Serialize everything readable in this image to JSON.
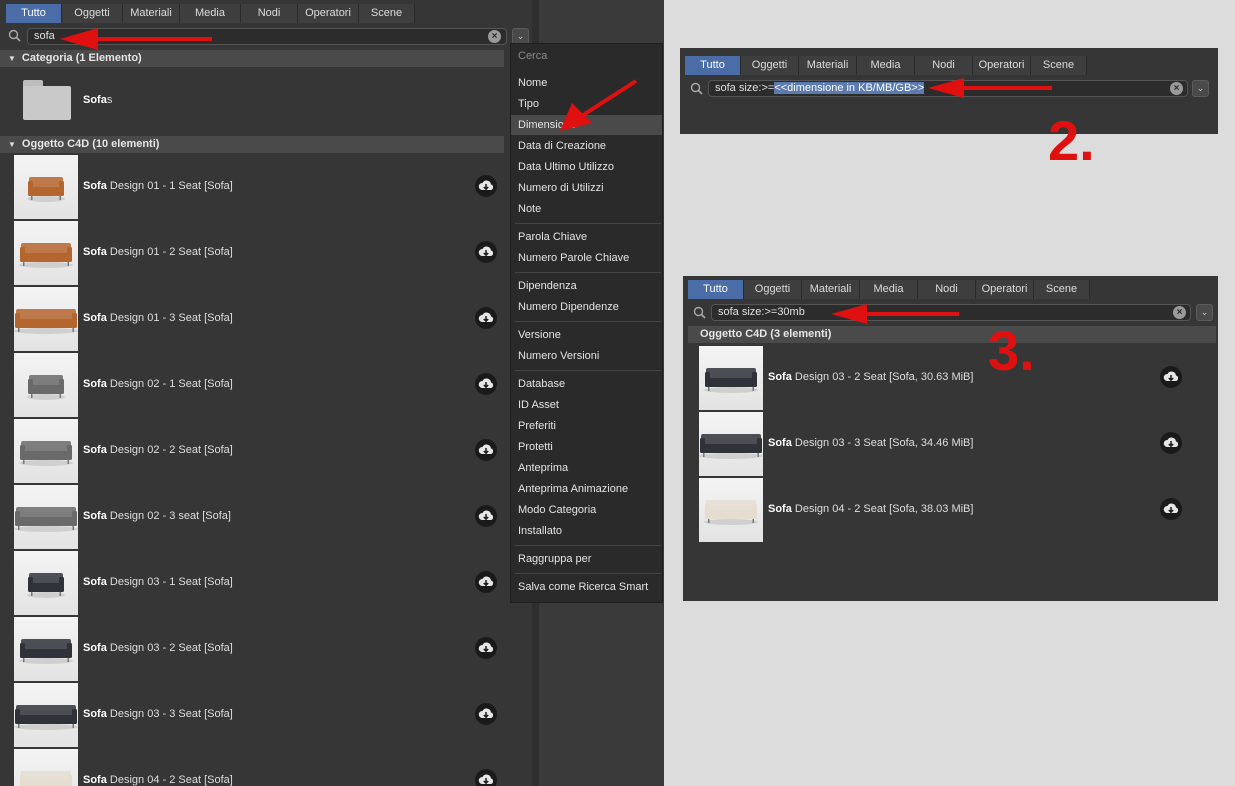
{
  "tabs": [
    "Tutto",
    "Oggetti",
    "Materiali",
    "Media",
    "Nodi",
    "Operatori",
    "Scene"
  ],
  "main": {
    "search_value": "sofa",
    "category_header": "Categoria (1 Elemento)",
    "folder_label_bold": "Sofa",
    "folder_label_rest": "s",
    "objects_header": "Oggetto C4D (10 elementi)",
    "items": [
      {
        "bold": "Sofa",
        "rest": " Design 01 - 1 Seat [Sofa]",
        "color": "#b5652e",
        "kind": "armchair"
      },
      {
        "bold": "Sofa",
        "rest": " Design 01 - 2 Seat [Sofa]",
        "color": "#b5652e",
        "kind": "sofa2"
      },
      {
        "bold": "Sofa",
        "rest": " Design 01 - 3 Seat [Sofa]",
        "color": "#b5652e",
        "kind": "sofa3"
      },
      {
        "bold": "Sofa",
        "rest": " Design 02 - 1 Seat [Sofa]",
        "color": "#6a6a6a",
        "kind": "armchair"
      },
      {
        "bold": "Sofa",
        "rest": " Design 02 - 2 Seat [Sofa]",
        "color": "#6a6a6a",
        "kind": "sofa2"
      },
      {
        "bold": "Sofa",
        "rest": " Design 02 - 3 seat [Sofa]",
        "color": "#6a6a6a",
        "kind": "sofa3"
      },
      {
        "bold": "Sofa",
        "rest": " Design 03 - 1 Seat [Sofa]",
        "color": "#2f3238",
        "kind": "armchair"
      },
      {
        "bold": "Sofa",
        "rest": " Design 03 - 2 Seat [Sofa]",
        "color": "#2f3238",
        "kind": "sofa2"
      },
      {
        "bold": "Sofa",
        "rest": " Design 03 - 3 Seat [Sofa]",
        "color": "#2f3238",
        "kind": "sofa3"
      },
      {
        "bold": "Sofa",
        "rest": " Design 04 - 2 Seat [Sofa]",
        "color": "#e4ddd0",
        "kind": "sofa2"
      }
    ]
  },
  "menu": {
    "header": "Cerca",
    "groups": [
      [
        "Nome",
        "Tipo",
        "Dimensione",
        "Data di Creazione",
        "Data Ultimo Utilizzo",
        "Numero di Utilizzi",
        "Note"
      ],
      [
        "Parola Chiave",
        "Numero Parole Chiave"
      ],
      [
        "Dipendenza",
        "Numero Dipendenze"
      ],
      [
        "Versione",
        "Numero Versioni"
      ],
      [
        "Database",
        "ID Asset",
        "Preferiti",
        "Protetti",
        "Anteprima",
        "Anteprima Animazione",
        "Modo Categoria",
        "Installato"
      ],
      [
        "Raggruppa per"
      ],
      [
        "Salva come Ricerca Smart"
      ]
    ],
    "selected": "Dimensione"
  },
  "panel2": {
    "search_prefix": "sofa size:>=",
    "search_highlight": "<<dimensione in KB/MB/GB>>",
    "step": "2."
  },
  "panel3": {
    "search_value": "sofa size:>=30mb",
    "header": "Oggetto C4D (3 elementi)",
    "step": "3.",
    "items": [
      {
        "bold": "Sofa",
        "rest": " Design 03 - 2 Seat [Sofa, 30.63 MiB]",
        "color": "#2f3238",
        "kind": "sofa2"
      },
      {
        "bold": "Sofa",
        "rest": " Design 03 - 3 Seat [Sofa, 34.46 MiB]",
        "color": "#2f3238",
        "kind": "sofa3"
      },
      {
        "bold": "Sofa",
        "rest": " Design 04 - 2 Seat [Sofa, 38.03 MiB]",
        "color": "#e4ddd0",
        "kind": "sofa2"
      }
    ]
  },
  "colors": {
    "accent_tab": "#4a6da7",
    "arrow": "#e01010"
  }
}
